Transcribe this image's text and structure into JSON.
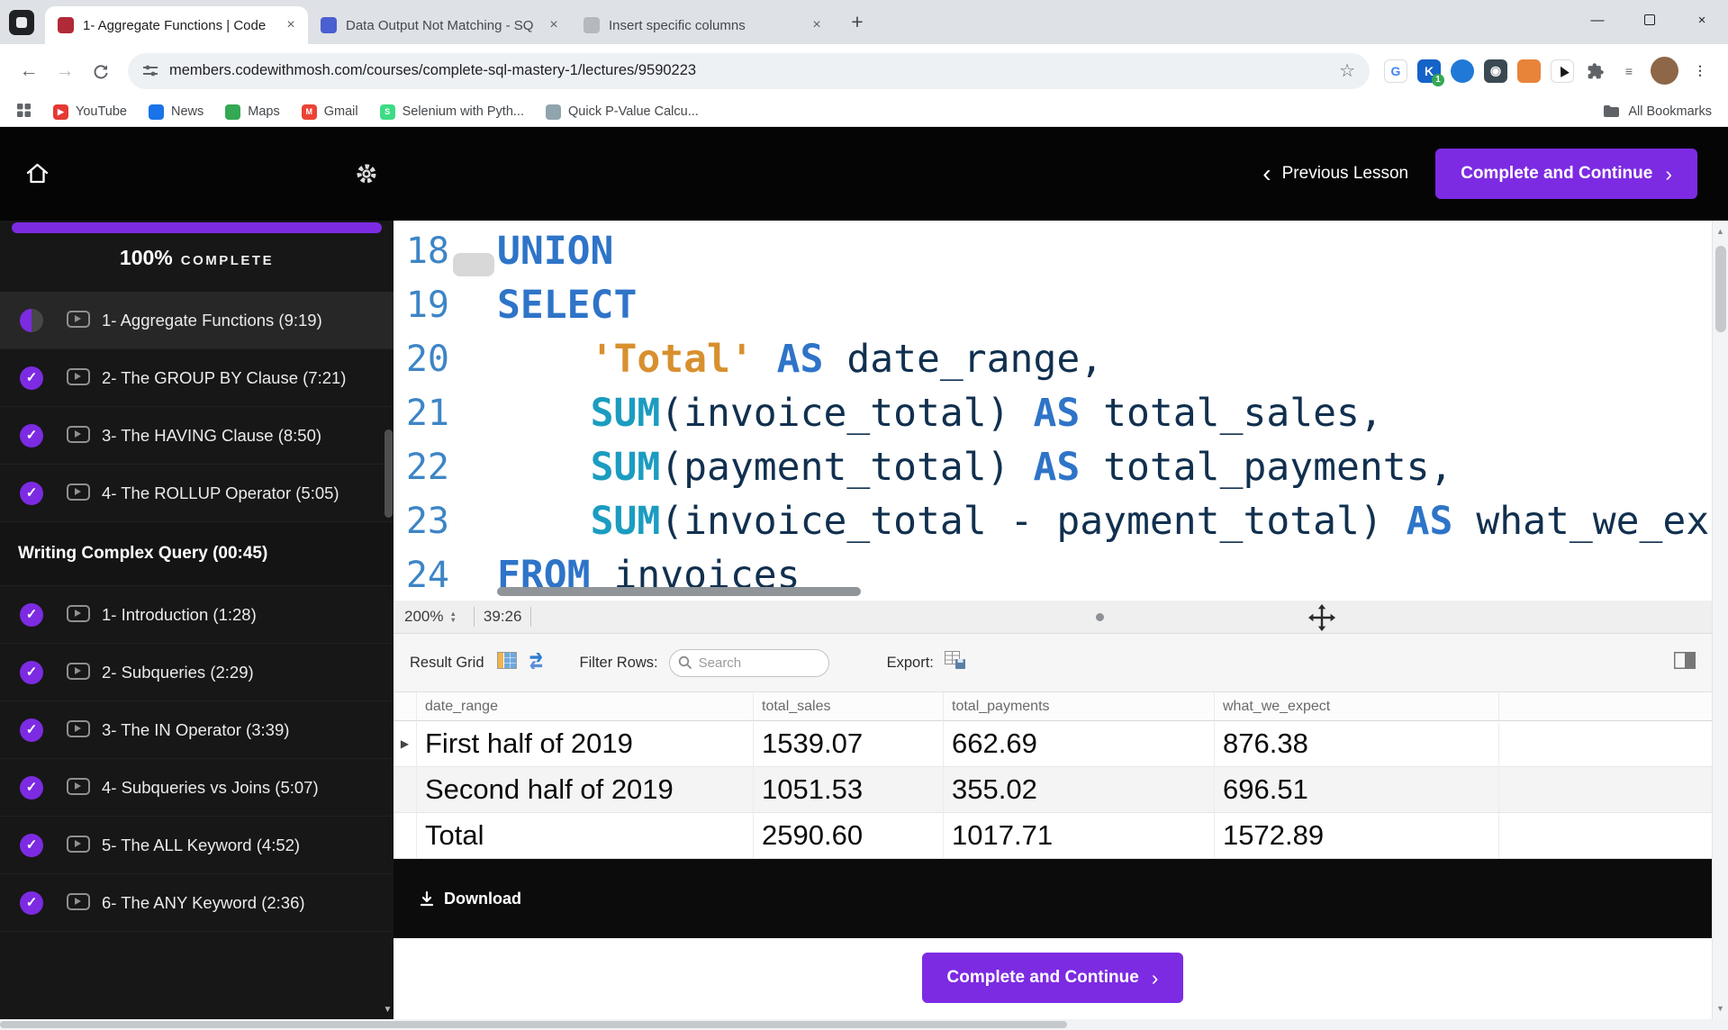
{
  "colors": {
    "accent_purple": "#7c2be2",
    "code_keyword": "#2e74c8",
    "code_function": "#1b9cc0",
    "code_string": "#d8902f",
    "code_plain": "#11304f",
    "line_number": "#3d85c6"
  },
  "icons": {
    "close_glyph": "×",
    "check_glyph": "✓",
    "row_marker_glyph": "▶",
    "back_glyph": "←",
    "forward_glyph": "→",
    "star_glyph": "☆",
    "menu_glyph": "⋮",
    "new_tab_glyph": "+",
    "minimize_glyph": "—",
    "prev_chevron": "‹",
    "next_chevron": "›",
    "stepper_up_glyph": "▲",
    "stepper_down_glyph": "▼",
    "scroll_up_glyph": "▲",
    "scroll_down_glyph": "▼"
  },
  "browser": {
    "tabs": [
      {
        "title": "1- Aggregate Functions | Code",
        "active": true,
        "favicon_color": "#b02a37"
      },
      {
        "title": "Data Output Not Matching - SQ",
        "active": false,
        "favicon_color": "#4a5fd0"
      },
      {
        "title": "Insert specific columns",
        "active": false,
        "favicon_color": "#b5b8bc"
      }
    ],
    "url": "members.codewithmosh.com/courses/complete-sql-mastery-1/lectures/9590223",
    "extensions": [
      {
        "name": "translate-extension-icon",
        "glyph": "G",
        "bg": "#ffffff",
        "fg": "#4285f4",
        "border": "#dadce0"
      },
      {
        "name": "keeper-extension-icon",
        "glyph": "K",
        "bg": "#1463c8",
        "fg": "#ffffff",
        "badge": "1",
        "badge_bg": "#34a853"
      },
      {
        "name": "blue-dot-extension-icon",
        "glyph": "",
        "bg": "#2079d6",
        "fg": "#ffffff",
        "round": true
      },
      {
        "name": "eye-extension-icon",
        "glyph": "◉",
        "bg": "#3b4a52",
        "fg": "#ffffff"
      },
      {
        "name": "orange-grid-extension-icon",
        "glyph": "",
        "bg": "#e8833a",
        "fg": "#ffffff"
      },
      {
        "name": "cursor-extension-icon",
        "glyph": "▶",
        "bg": "#ffffff",
        "fg": "#16181b",
        "border": "#dadce0",
        "rotate": true
      },
      {
        "name": "extensions-puzzle-icon",
        "svg": "puzzle",
        "bg": "#ffffff",
        "fg": "#5f6368"
      },
      {
        "name": "reading-list-icon",
        "glyph": "≡",
        "bg": "#ffffff",
        "fg": "#5f6368"
      },
      {
        "name": "profile-avatar",
        "glyph": "",
        "bg": "#8d6748",
        "fg": "#ffffff",
        "round": true,
        "big": true
      },
      {
        "name": "browser-menu-icon",
        "glyph": "⋮",
        "bg": "#ffffff",
        "fg": "#3c4043"
      }
    ],
    "bookmarks": [
      {
        "label": "YouTube",
        "color": "#e53935",
        "glyph": "▶"
      },
      {
        "label": "News",
        "color": "#1a73e8",
        "glyph": ""
      },
      {
        "label": "Maps",
        "color": "#34a853",
        "glyph": ""
      },
      {
        "label": "Gmail",
        "color": "#ea4335",
        "glyph": "M"
      },
      {
        "label": "Selenium with Pyth...",
        "color": "#3ddc84",
        "glyph": "S"
      },
      {
        "label": "Quick P-Value Calcu...",
        "color": "#90a4ae",
        "glyph": ""
      }
    ],
    "all_bookmarks_label": "All Bookmarks"
  },
  "lesson_header": {
    "previous_label": "Previous Lesson",
    "continue_label": "Complete and Continue"
  },
  "sidebar": {
    "progress_percent": "100%",
    "progress_suffix": "COMPLETE",
    "sections": [
      {
        "header": "",
        "items": [
          {
            "label": "1- Aggregate Functions (9:19)",
            "status": "partial",
            "active": true
          },
          {
            "label": "2- The GROUP BY Clause (7:21)",
            "status": "done",
            "active": false
          },
          {
            "label": "3- The HAVING Clause (8:50)",
            "status": "done",
            "active": false
          },
          {
            "label": "4- The ROLLUP Operator (5:05)",
            "status": "done",
            "active": false
          }
        ]
      },
      {
        "header": "Writing Complex Query (00:45)",
        "items": [
          {
            "label": "1- Introduction (1:28)",
            "status": "done",
            "active": false
          },
          {
            "label": "2- Subqueries (2:29)",
            "status": "done",
            "active": false
          },
          {
            "label": "3- The IN Operator (3:39)",
            "status": "done",
            "active": false
          },
          {
            "label": "4- Subqueries vs Joins (5:07)",
            "status": "done",
            "active": false
          },
          {
            "label": "5- The ALL Keyword (4:52)",
            "status": "done",
            "active": false
          },
          {
            "label": "6- The ANY Keyword (2:36)",
            "status": "done",
            "active": false
          }
        ]
      }
    ]
  },
  "player": {
    "zoom_level": "200%",
    "timestamp": "39:26"
  },
  "editor": {
    "lines": [
      {
        "num": "18",
        "tokens": [
          [
            "UNION",
            "kw"
          ]
        ]
      },
      {
        "num": "19",
        "tokens": [
          [
            "SELECT",
            "kw"
          ]
        ]
      },
      {
        "num": "20",
        "tokens": [
          [
            "    ",
            "pl"
          ],
          [
            "'Total'",
            "str"
          ],
          [
            " ",
            "pl"
          ],
          [
            "AS",
            "kw"
          ],
          [
            " date_range,",
            "pl"
          ]
        ]
      },
      {
        "num": "21",
        "tokens": [
          [
            "    ",
            "pl"
          ],
          [
            "SUM",
            "fn"
          ],
          [
            "(invoice_total) ",
            "pl"
          ],
          [
            "AS",
            "kw"
          ],
          [
            " total_sales,",
            "pl"
          ]
        ]
      },
      {
        "num": "22",
        "tokens": [
          [
            "    ",
            "pl"
          ],
          [
            "SUM",
            "fn"
          ],
          [
            "(payment_total) ",
            "pl"
          ],
          [
            "AS",
            "kw"
          ],
          [
            " total_payments,",
            "pl"
          ]
        ]
      },
      {
        "num": "23",
        "tokens": [
          [
            "    ",
            "pl"
          ],
          [
            "SUM",
            "fn"
          ],
          [
            "(invoice_total - payment_total) ",
            "pl"
          ],
          [
            "AS",
            "kw"
          ],
          [
            " what_we_expect",
            "pl"
          ]
        ]
      },
      {
        "num": "24",
        "tokens": [
          [
            "FROM",
            "kw"
          ],
          [
            " invoices",
            "pl"
          ]
        ]
      }
    ]
  },
  "result_grid": {
    "title": "Result Grid",
    "filter_label": "Filter Rows:",
    "search_placeholder": "Search",
    "export_label": "Export:",
    "columns": [
      "date_range",
      "total_sales",
      "total_payments",
      "what_we_expect"
    ],
    "rows": [
      [
        "First half of 2019",
        "1539.07",
        "662.69",
        "876.38"
      ],
      [
        "Second half of 2019",
        "1051.53",
        "355.02",
        "696.51"
      ],
      [
        "Total",
        "2590.60",
        "1017.71",
        "1572.89"
      ]
    ]
  },
  "footer": {
    "download_label": "Download",
    "continue_label": "Complete and Continue"
  }
}
